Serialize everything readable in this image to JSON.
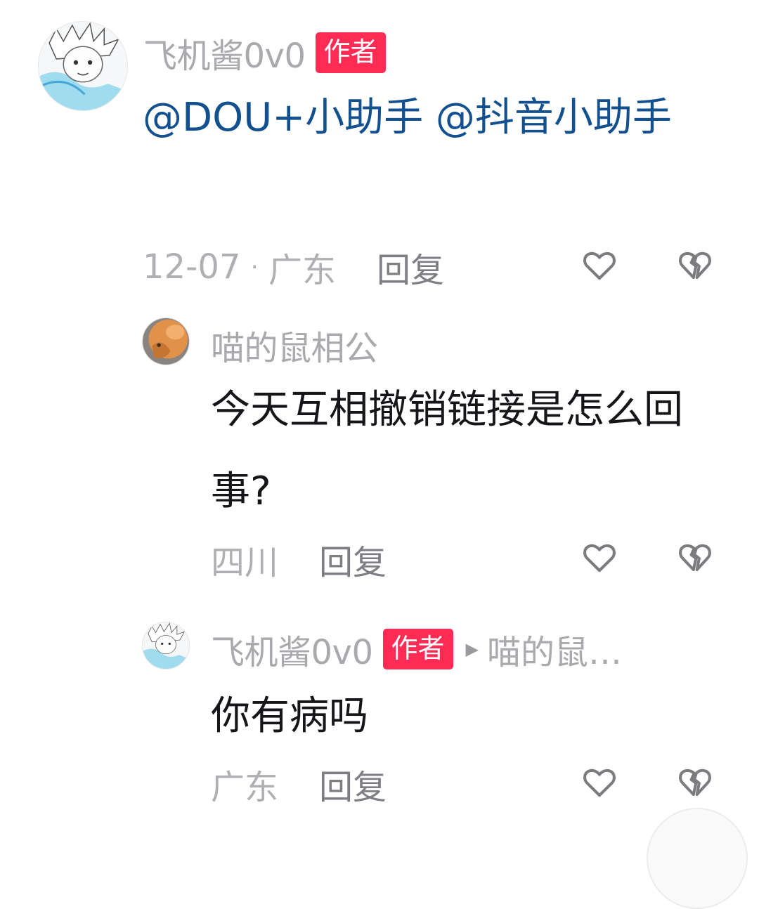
{
  "comments": [
    {
      "username": "飞机酱0v0",
      "badge": "作者",
      "mention1": "@DOU+小助手",
      "mention2": "@抖音小助手",
      "date": "12-07",
      "dot": "·",
      "location": "广东",
      "reply_label": "回复",
      "avatar_icon": "anime-white-hair-avatar-icon"
    }
  ],
  "replies": [
    {
      "username": "喵的鼠相公",
      "text": "今天互相撤销链接是怎么回事?",
      "location": "四川",
      "reply_label": "回复",
      "avatar_icon": "orange-cat-avatar-icon"
    },
    {
      "username": "飞机酱0v0",
      "badge": "作者",
      "reply_arrow": "▶",
      "reply_target": "喵的鼠…",
      "text": "你有病吗",
      "location": "广东",
      "reply_label": "回复",
      "avatar_icon": "anime-white-hair-avatar-icon"
    }
  ],
  "icons": {
    "like": "heart-outline-icon",
    "dislike": "broken-heart-icon"
  },
  "colors": {
    "badge": "#fe2c55",
    "mention": "#13508f",
    "username": "#a9a9ae",
    "text": "#16161a"
  }
}
